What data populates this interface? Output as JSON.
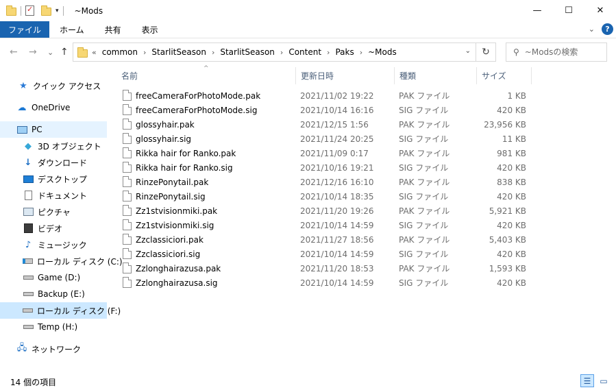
{
  "title_bar": {
    "title": "~Mods",
    "qat_dropdown": "▾",
    "minimize": "—",
    "maximize": "☐",
    "close": "✕"
  },
  "ribbon": {
    "tabs": [
      "ファイル",
      "ホーム",
      "共有",
      "表示"
    ],
    "expand_chevron": "⌄",
    "help": "?"
  },
  "nav": {
    "back": "←",
    "forward": "→",
    "recent": "⌄",
    "up": "↑",
    "address_overflow": "«",
    "breadcrumbs": [
      "common",
      "StarlitSeason",
      "StarlitSeason",
      "Content",
      "Paks",
      "~Mods"
    ],
    "address_dropdown": "⌄",
    "refresh": "↻",
    "search_placeholder": "~Modsの検索"
  },
  "sidebar": {
    "items": [
      {
        "label": "クイック アクセス",
        "icon": "star-icon"
      },
      {
        "label": "OneDrive",
        "icon": "cloud-icon"
      },
      {
        "label": "PC",
        "icon": "pc-icon"
      },
      {
        "label": "3D オブジェクト",
        "icon": "cube-icon"
      },
      {
        "label": "ダウンロード",
        "icon": "download-icon"
      },
      {
        "label": "デスクトップ",
        "icon": "desktop-icon"
      },
      {
        "label": "ドキュメント",
        "icon": "document-icon"
      },
      {
        "label": "ピクチャ",
        "icon": "picture-icon"
      },
      {
        "label": "ビデオ",
        "icon": "video-icon"
      },
      {
        "label": "ミュージック",
        "icon": "music-icon"
      },
      {
        "label": "ローカル ディスク (C:)",
        "icon": "windows-drive-icon"
      },
      {
        "label": "Game (D:)",
        "icon": "drive-icon"
      },
      {
        "label": "Backup (E:)",
        "icon": "drive-icon"
      },
      {
        "label": "ローカル ディスク (F:)",
        "icon": "drive-icon"
      },
      {
        "label": "Temp (H:)",
        "icon": "drive-icon"
      },
      {
        "label": "ネットワーク",
        "icon": "network-icon"
      }
    ]
  },
  "columns": {
    "name": "名前",
    "date": "更新日時",
    "type": "種類",
    "size": "サイズ",
    "sort_indicator": "^"
  },
  "files": [
    {
      "name": "freeCameraForPhotoMode.pak",
      "date": "2021/11/02 19:22",
      "type": "PAK ファイル",
      "size": "1 KB"
    },
    {
      "name": "freeCameraForPhotoMode.sig",
      "date": "2021/10/14 16:16",
      "type": "SIG ファイル",
      "size": "420 KB"
    },
    {
      "name": "glossyhair.pak",
      "date": "2021/12/15 1:56",
      "type": "PAK ファイル",
      "size": "23,956 KB"
    },
    {
      "name": "glossyhair.sig",
      "date": "2021/11/24 20:25",
      "type": "SIG ファイル",
      "size": "11 KB"
    },
    {
      "name": "Rikka hair for Ranko.pak",
      "date": "2021/11/09 0:17",
      "type": "PAK ファイル",
      "size": "981 KB"
    },
    {
      "name": "Rikka hair for Ranko.sig",
      "date": "2021/10/16 19:21",
      "type": "SIG ファイル",
      "size": "420 KB"
    },
    {
      "name": "RinzePonytail.pak",
      "date": "2021/12/16 16:10",
      "type": "PAK ファイル",
      "size": "838 KB"
    },
    {
      "name": "RinzePonytail.sig",
      "date": "2021/10/14 18:35",
      "type": "SIG ファイル",
      "size": "420 KB"
    },
    {
      "name": "Zz1stvisionmiki.pak",
      "date": "2021/11/20 19:26",
      "type": "PAK ファイル",
      "size": "5,921 KB"
    },
    {
      "name": "Zz1stvisionmiki.sig",
      "date": "2021/10/14 14:59",
      "type": "SIG ファイル",
      "size": "420 KB"
    },
    {
      "name": "Zzclassiciori.pak",
      "date": "2021/11/27 18:56",
      "type": "PAK ファイル",
      "size": "5,403 KB"
    },
    {
      "name": "Zzclassiciori.sig",
      "date": "2021/10/14 14:59",
      "type": "SIG ファイル",
      "size": "420 KB"
    },
    {
      "name": "Zzlonghairazusa.pak",
      "date": "2021/11/20 18:53",
      "type": "PAK ファイル",
      "size": "1,593 KB"
    },
    {
      "name": "Zzlonghairazusa.sig",
      "date": "2021/10/14 14:59",
      "type": "SIG ファイル",
      "size": "420 KB"
    }
  ],
  "status": {
    "item_count": "14 個の項目"
  },
  "colors": {
    "accent": "#1a64b0",
    "selection": "#cce8ff",
    "hover": "#e5f3ff",
    "folder": "#f7d774"
  }
}
